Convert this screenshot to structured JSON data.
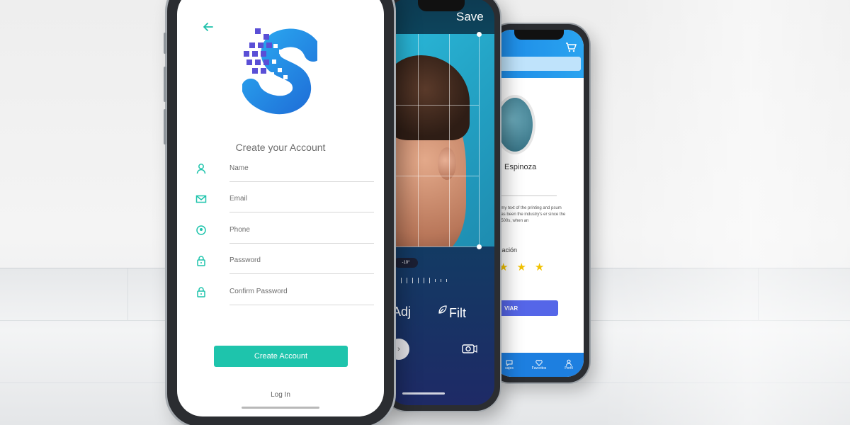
{
  "colors": {
    "accent_teal": "#1ec4ac",
    "logo_blue": "#2a8fe6",
    "logo_purple": "#5a4fd6",
    "profile_header": "#1d8ae6",
    "profile_button": "#5566e8",
    "star": "#f2c200"
  },
  "phone1": {
    "back_icon": "arrow-left-icon",
    "logo_icon": "pixel-s-logo",
    "title": "Create your Account",
    "fields": [
      {
        "icon": "user-icon",
        "label": "Name"
      },
      {
        "icon": "mail-icon",
        "label": "Email"
      },
      {
        "icon": "location-pin-icon",
        "label": "Phone"
      },
      {
        "icon": "lock-icon",
        "label": "Password"
      },
      {
        "icon": "lock-icon",
        "label": "Confirm Password"
      }
    ],
    "create_button": "Create Account",
    "login_link": "Log In"
  },
  "phone2": {
    "save_label": "Save",
    "angle_label": "-10°",
    "tools": {
      "adjust": "Adj",
      "filter": "Filt"
    },
    "play_icon": "chevron-right-icon",
    "camera_icon": "camera-icon"
  },
  "phone3": {
    "cart_icon": "cart-icon",
    "profile_name": "Espinoza",
    "description": "nmy text of the printing and psum has been the industry's er since the 1500s, when an",
    "section_label": "cación",
    "rating_stars": "★★★",
    "rating_visible": 3,
    "action_button": "VIAR",
    "tabs": [
      {
        "icon": "chat-icon",
        "label": "sajes"
      },
      {
        "icon": "heart-icon",
        "label": "Favoritos"
      },
      {
        "icon": "user-icon",
        "label": "Perfil"
      }
    ]
  }
}
